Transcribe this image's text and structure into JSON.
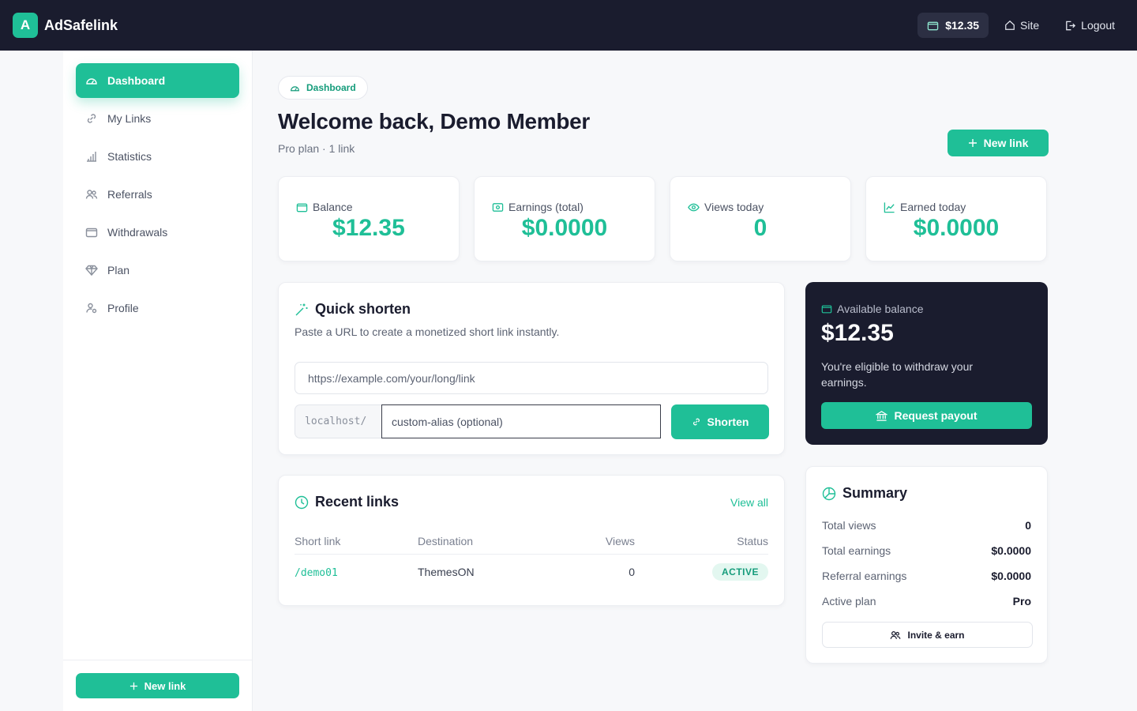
{
  "brand": {
    "badge": "A",
    "name": "AdSafelink"
  },
  "topbar": {
    "balance": "$12.35",
    "site": "Site",
    "logout": "Logout"
  },
  "sidebar": {
    "items": [
      {
        "label": "Dashboard",
        "icon": "gauge-icon",
        "active": true
      },
      {
        "label": "My Links",
        "icon": "link-icon"
      },
      {
        "label": "Statistics",
        "icon": "bar-chart-icon"
      },
      {
        "label": "Referrals",
        "icon": "users-icon"
      },
      {
        "label": "Withdrawals",
        "icon": "wallet-icon"
      },
      {
        "label": "Plan",
        "icon": "gem-icon"
      },
      {
        "label": "Profile",
        "icon": "user-gear-icon"
      }
    ],
    "new_link": "New link"
  },
  "header": {
    "crumb": "Dashboard",
    "title": "Welcome back, Demo Member",
    "subtitle": "Pro plan · 1 link",
    "new_link": "New link"
  },
  "stats": [
    {
      "label": "Balance",
      "value": "$12.35",
      "icon": "wallet-icon"
    },
    {
      "label": "Earnings (total)",
      "value": "$0.0000",
      "icon": "cash-icon"
    },
    {
      "label": "Views today",
      "value": "0",
      "icon": "eye-icon"
    },
    {
      "label": "Earned today",
      "value": "$0.0000",
      "icon": "trend-up-icon"
    }
  ],
  "quick_shorten": {
    "title": "Quick shorten",
    "description": "Paste a URL to create a monetized short link instantly.",
    "url_placeholder": "https://example.com/your/long/link",
    "prefix": "localhost/",
    "alias_placeholder": "custom-alias (optional)",
    "button": "Shorten"
  },
  "recent_links": {
    "title": "Recent links",
    "view_all": "View all",
    "columns": [
      "Short link",
      "Destination",
      "Views",
      "Status"
    ],
    "rows": [
      {
        "short": "/demo01",
        "destination": "ThemesON",
        "views": "0",
        "status": "ACTIVE"
      }
    ]
  },
  "balance_card": {
    "label": "Available balance",
    "amount": "$12.35",
    "description": "You're eligible to withdraw your earnings.",
    "button": "Request payout"
  },
  "summary": {
    "title": "Summary",
    "rows": [
      {
        "label": "Total views",
        "value": "0"
      },
      {
        "label": "Total earnings",
        "value": "$0.0000"
      },
      {
        "label": "Referral earnings",
        "value": "$0.0000"
      },
      {
        "label": "Active plan",
        "value": "Pro"
      }
    ],
    "invite": "Invite & earn"
  },
  "colors": {
    "accent": "#1fbf97",
    "dark": "#1a1c2e",
    "active_badge_bg": "#e3f7f0"
  }
}
